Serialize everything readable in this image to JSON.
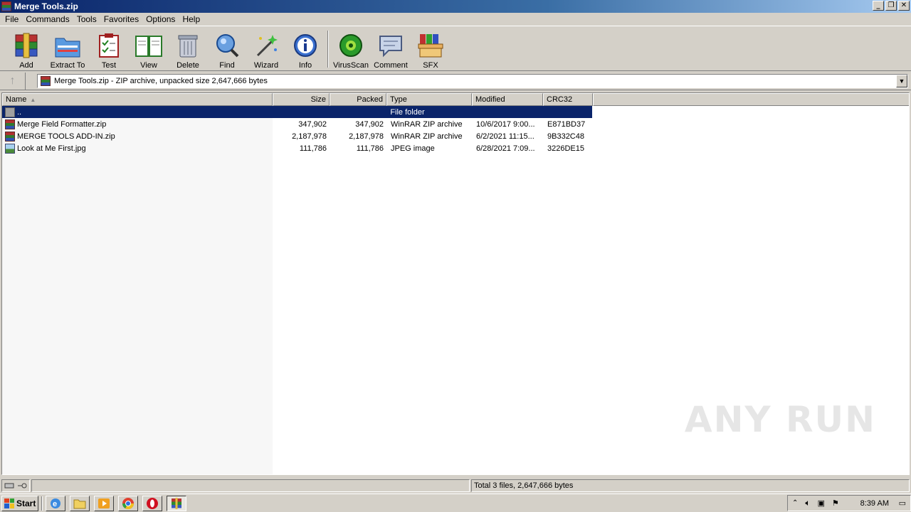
{
  "window": {
    "title": "Merge Tools.zip",
    "controls": [
      "_",
      "❐",
      "✕"
    ]
  },
  "menu": [
    "File",
    "Commands",
    "Tools",
    "Favorites",
    "Options",
    "Help"
  ],
  "toolbar": {
    "add": "Add",
    "extract": "Extract To",
    "test": "Test",
    "view": "View",
    "delete": "Delete",
    "find": "Find",
    "wizard": "Wizard",
    "info": "Info",
    "virusscan": "VirusScan",
    "comment": "Comment",
    "sfx": "SFX"
  },
  "address": {
    "path": "Merge Tools.zip - ZIP archive, unpacked size 2,647,666 bytes"
  },
  "columns": {
    "name": "Name",
    "size": "Size",
    "packed": "Packed",
    "type": "Type",
    "modified": "Modified",
    "crc": "CRC32"
  },
  "files": [
    {
      "name": "..",
      "size": "",
      "packed": "",
      "type": "File folder",
      "modified": "",
      "crc": ""
    },
    {
      "name": "Merge Field Formatter.zip",
      "size": "347,902",
      "packed": "347,902",
      "type": "WinRAR ZIP archive",
      "modified": "10/6/2017 9:00...",
      "crc": "E871BD37"
    },
    {
      "name": "MERGE TOOLS ADD-IN.zip",
      "size": "2,187,978",
      "packed": "2,187,978",
      "type": "WinRAR ZIP archive",
      "modified": "6/2/2021 11:15...",
      "crc": "9B332C48"
    },
    {
      "name": "Look at Me First.jpg",
      "size": "111,786",
      "packed": "111,786",
      "type": "JPEG image",
      "modified": "6/28/2021 7:09...",
      "crc": "3226DE15"
    }
  ],
  "status": {
    "total": "Total 3 files, 2,647,666 bytes"
  },
  "watermark": "ANY RUN",
  "taskbar": {
    "start": "Start",
    "clock": "8:39 AM"
  }
}
